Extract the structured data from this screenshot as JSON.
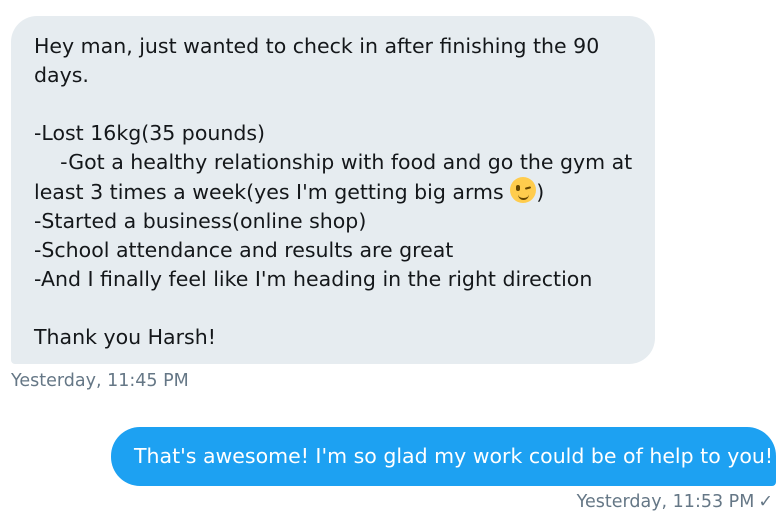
{
  "incoming_message": {
    "lines": [
      "Hey man, just wanted to check in after finishing the 90",
      "days.",
      "",
      "-Lost 16kg(35 pounds)",
      "    -Got a healthy relationship with food and go the gym at",
      "least 3 times a week(yes I'm getting big arms ",
      ")",
      "-Started a business(online shop)",
      "-School attendance and results are great",
      "-And I finally feel like I'm heading in the right direction",
      "",
      "Thank you Harsh!"
    ],
    "emoji": "winking-face",
    "timestamp": "Yesterday, 11:45 PM"
  },
  "outgoing_message": {
    "text": "That's awesome! I'm so glad my work could be of help to you!",
    "timestamp": "Yesterday, 11:53 PM",
    "status_icon": "check-icon",
    "status_glyph": "✓"
  },
  "colors": {
    "incoming_bubble": "#e6ecf0",
    "outgoing_bubble": "#1da1f2",
    "timestamp": "#657786"
  }
}
